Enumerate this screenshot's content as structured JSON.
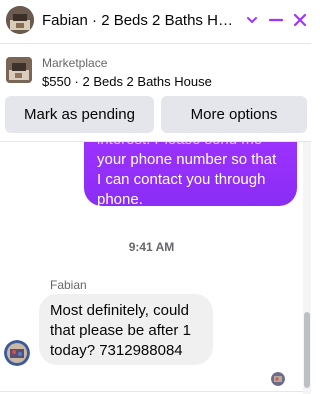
{
  "header": {
    "title": "Fabian · 2 Beds 2 Baths Ho...",
    "icons": [
      "avatar",
      "chevron-down-icon",
      "minimize-icon",
      "close-icon"
    ],
    "accent": "#a033ff"
  },
  "listing": {
    "category": "Marketplace",
    "price_line": "$550 · 2 Beds 2 Baths House"
  },
  "actions": {
    "mark_pending": "Mark as pending",
    "more_options": "More options"
  },
  "chat": {
    "outgoing": {
      "line1": "interest. Please send me",
      "line2": "your phone number so that",
      "line3": "I can contact you through",
      "line4": "phone."
    },
    "timestamp": "9:41 AM",
    "incoming": {
      "sender": "Fabian",
      "line1": "Most definitely, could",
      "line2": "that please be after 1",
      "line3": "today? 7312988084"
    },
    "colors": {
      "outgoing_bubble": "#8a2df5",
      "incoming_bubble": "#f0f0f0"
    }
  }
}
